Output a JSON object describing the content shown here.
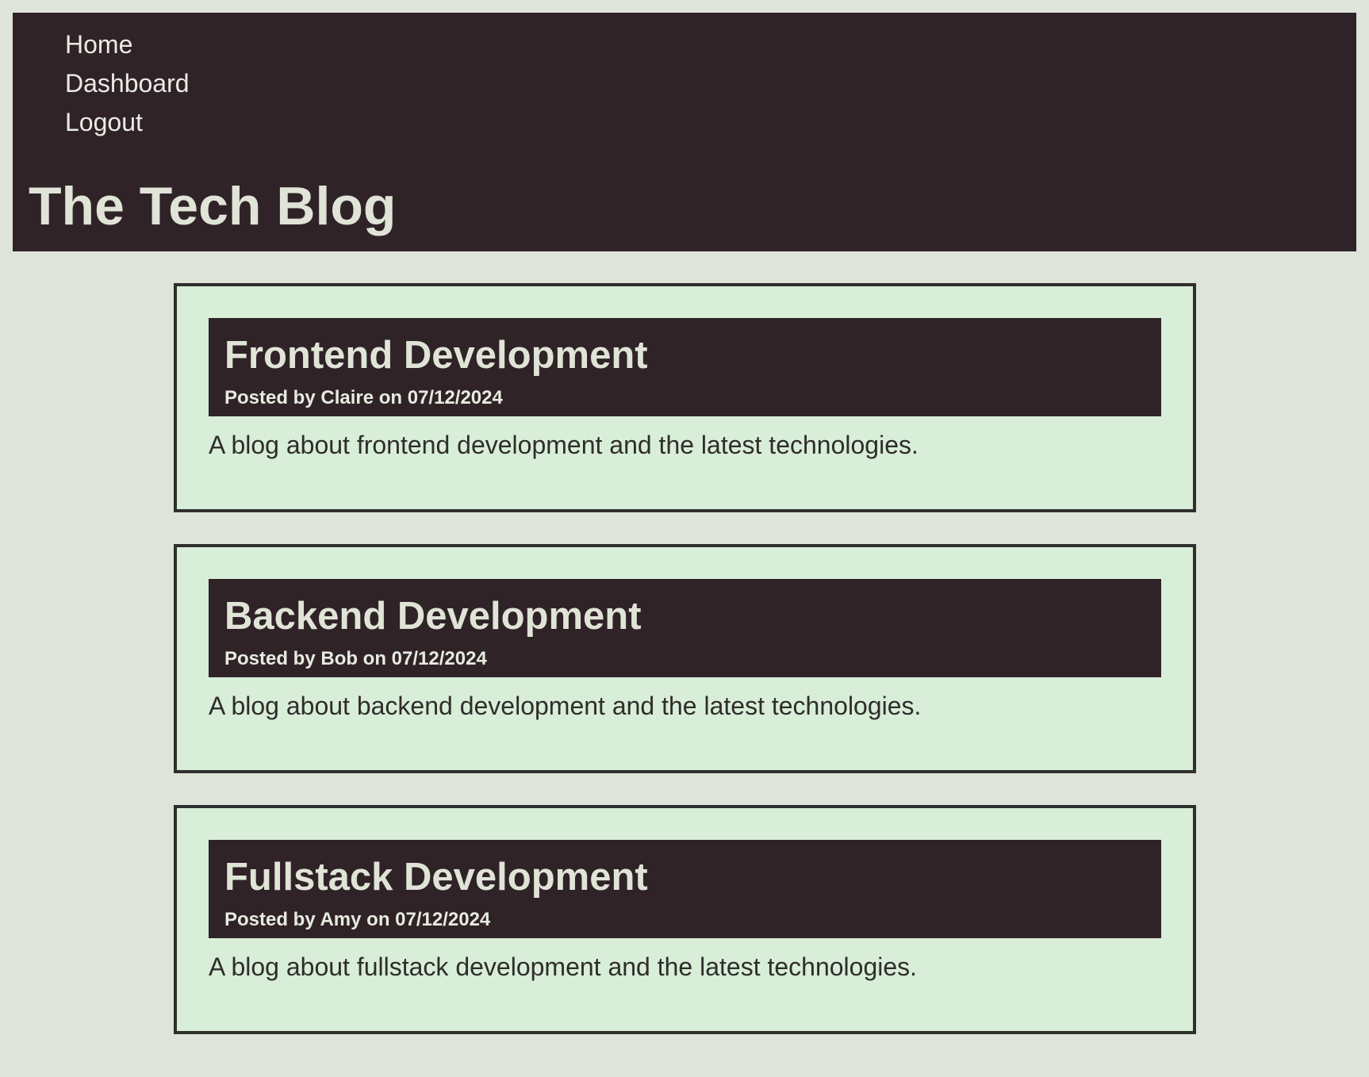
{
  "nav": {
    "items": [
      {
        "label": "Home"
      },
      {
        "label": "Dashboard"
      },
      {
        "label": "Logout"
      }
    ]
  },
  "header": {
    "title": "The Tech Blog"
  },
  "posts": [
    {
      "title": "Frontend Development",
      "meta": "Posted by Claire on 07/12/2024",
      "body": "A blog about frontend development and the latest technologies."
    },
    {
      "title": "Backend Development",
      "meta": "Posted by Bob on 07/12/2024",
      "body": "A blog about backend development and the latest technologies."
    },
    {
      "title": "Fullstack Development",
      "meta": "Posted by Amy on 07/12/2024",
      "body": "A blog about fullstack development and the latest technologies."
    }
  ],
  "colors": {
    "page_background": "#dee4da",
    "header_background": "#2f2328",
    "card_background": "#d8eed8",
    "card_border": "#2f2f2d",
    "light_text": "#e0e4d6",
    "dark_text": "#2f2d2b"
  }
}
